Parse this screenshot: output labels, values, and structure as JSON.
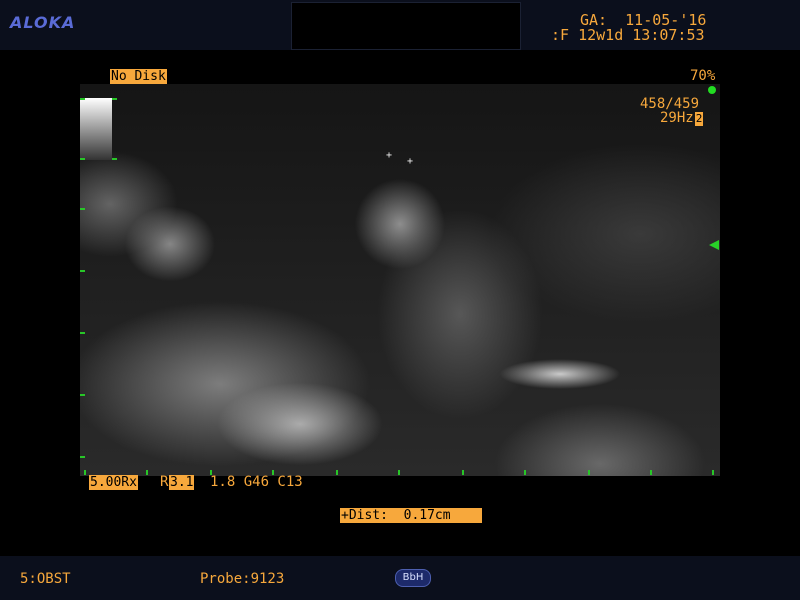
{
  "header": {
    "brand": "ALOKA",
    "ga_line": "GA:  11-05-'16",
    "date_line": ":F 12w1d 13:07:53"
  },
  "overlay": {
    "disk_status": "No Disk",
    "power_percent": "70%",
    "frame_counter": "458/459",
    "frame_rate": "29Hz",
    "frame_rate_badge": "2",
    "caliper_1": "+",
    "caliper_2": "+"
  },
  "settings": {
    "frequency": "5.00Rx",
    "range_label": "R",
    "range_value": "3.1",
    "params": "1.8 G46 C13"
  },
  "measurement": {
    "icon": "+",
    "label": "Dist:  0.17cm"
  },
  "footer": {
    "exam_preset": "5:OBST",
    "probe": "Probe:9123",
    "bbh_label": "BbH"
  },
  "colors": {
    "text_accent": "#f7a83c",
    "brand": "#5a6bd6",
    "marker_green": "#28c628",
    "bar_background": "#0b0f1c"
  }
}
